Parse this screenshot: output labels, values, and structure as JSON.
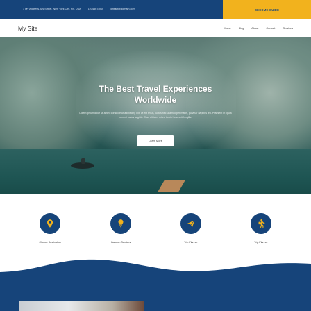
{
  "topbar": {
    "address": "1 My Address, My Street, New York City, NY, USA",
    "phone": "1234567890",
    "email": "contact@domain.com",
    "guide_button": "BECOME GUIDE"
  },
  "nav": {
    "logo": "My Site",
    "items": [
      "Home",
      "Blog",
      "About",
      "Contact",
      "Services"
    ]
  },
  "hero": {
    "title_line1": "The Best Travel Experiences",
    "title_line2": "Worldwide",
    "text": "Lorem ipsum dolor sit amet, consectetur adipiscing elit. Ut elit tellus, luctus nec ullamcorper mattis, pulvinar dapibus leo. Praesent ut ligula non mi varius sagittis. Cras ultricies mi eu turpis hendrerit fringilla.",
    "button": "Learn More"
  },
  "services": [
    {
      "label": "Choose Destination",
      "icon": "map-marker-icon"
    },
    {
      "label": "Caravan Services",
      "icon": "ice-cream-icon"
    },
    {
      "label": "Trip Planner",
      "icon": "paper-plane-icon"
    },
    {
      "label": "Trip Planner",
      "icon": "hiker-icon"
    }
  ],
  "colors": {
    "primary": "#16447a",
    "accent": "#f2b21d"
  }
}
